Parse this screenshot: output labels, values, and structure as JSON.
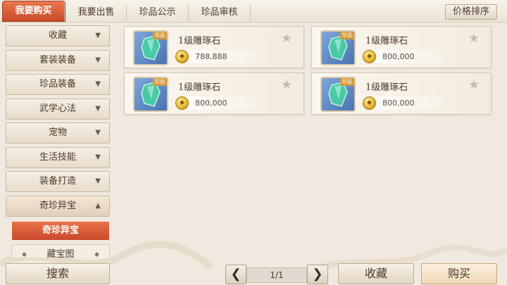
{
  "tabs": [
    {
      "label": "我要购买",
      "active": true
    },
    {
      "label": "我要出售",
      "active": false
    },
    {
      "label": "珍品公示",
      "active": false
    },
    {
      "label": "珍品审核",
      "active": false
    }
  ],
  "sort_label": "价格排序",
  "sidebar": {
    "categories": [
      "收藏",
      "套装装备",
      "珍品装备",
      "武学心法",
      "宠物",
      "生活技能",
      "装备打造",
      "奇珍异宝"
    ],
    "subitems": [
      "奇珍异宝",
      "藏宝图"
    ]
  },
  "items": [
    {
      "name": "1级雕琢石",
      "price": "788,888",
      "tag": "珍品"
    },
    {
      "name": "1级雕琢石",
      "price": "800,000",
      "tag": "珍品"
    },
    {
      "name": "1级雕琢石",
      "price": "800,000",
      "tag": "珍品"
    },
    {
      "name": "1级雕琢石",
      "price": "800,000",
      "tag": "珍品"
    }
  ],
  "bottom": {
    "search_label": "搜索",
    "page": "1/1",
    "favorite_label": "收藏",
    "buy_label": "购买"
  },
  "colors": {
    "accent": "#d25a35",
    "gem": "#49c9a6"
  }
}
